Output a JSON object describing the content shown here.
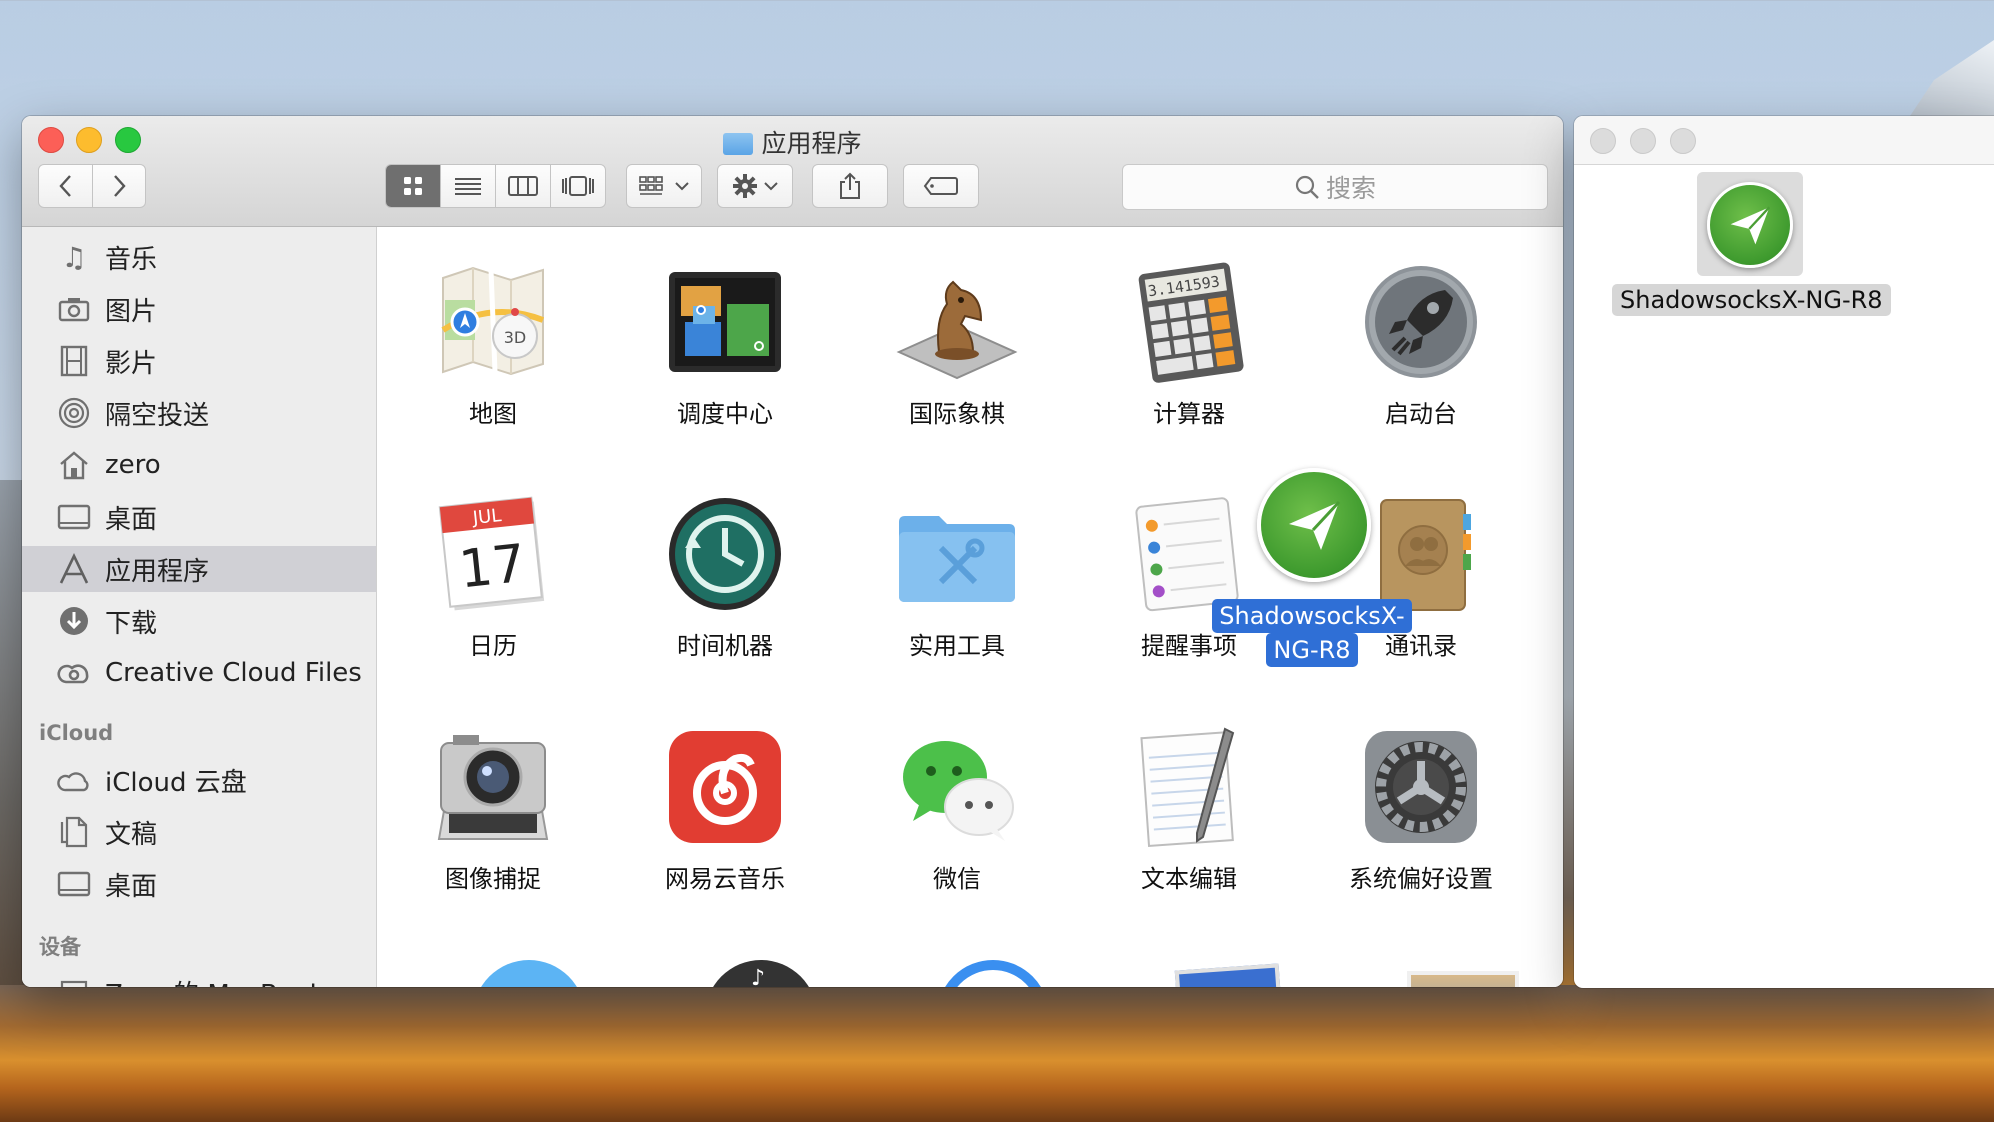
{
  "finder": {
    "title": "应用程序",
    "search_placeholder": "搜索",
    "sidebar": {
      "favorites": [
        {
          "label": "音乐",
          "icon": "music-note-icon"
        },
        {
          "label": "图片",
          "icon": "camera-icon"
        },
        {
          "label": "影片",
          "icon": "film-icon"
        },
        {
          "label": "隔空投送",
          "icon": "airdrop-icon"
        },
        {
          "label": "zero",
          "icon": "home-icon"
        },
        {
          "label": "桌面",
          "icon": "desktop-icon"
        },
        {
          "label": "应用程序",
          "icon": "applications-icon",
          "selected": true
        },
        {
          "label": "下载",
          "icon": "download-icon"
        },
        {
          "label": "Creative Cloud Files",
          "icon": "creative-cloud-icon"
        }
      ],
      "icloud_header": "iCloud",
      "icloud": [
        {
          "label": "iCloud 云盘",
          "icon": "cloud-icon"
        },
        {
          "label": "文稿",
          "icon": "document-icon"
        },
        {
          "label": "桌面",
          "icon": "desktop-icon"
        }
      ],
      "devices_header": "设备",
      "devices": [
        {
          "label": "Zero 的 MacBook",
          "icon": "laptop-icon"
        }
      ]
    },
    "apps_row1": [
      "地图",
      "调度中心",
      "国际象棋",
      "计算器",
      "启动台"
    ],
    "apps_row2": [
      "日历",
      "时间机器",
      "实用工具",
      "提醒事项",
      "通讯录"
    ],
    "apps_row3": [
      "图像捕捉",
      "网易云音乐",
      "微信",
      "文本编辑",
      "系统偏好设置"
    ],
    "calendar_month": "JUL",
    "calendar_day": "17",
    "calculator_display": "3.141593",
    "maps_badge": "3D",
    "dragging": {
      "line1": "ShadowsocksX-",
      "line2": "NG-R8"
    }
  },
  "second_window": {
    "item_label": "ShadowsocksX-NG-R8"
  }
}
